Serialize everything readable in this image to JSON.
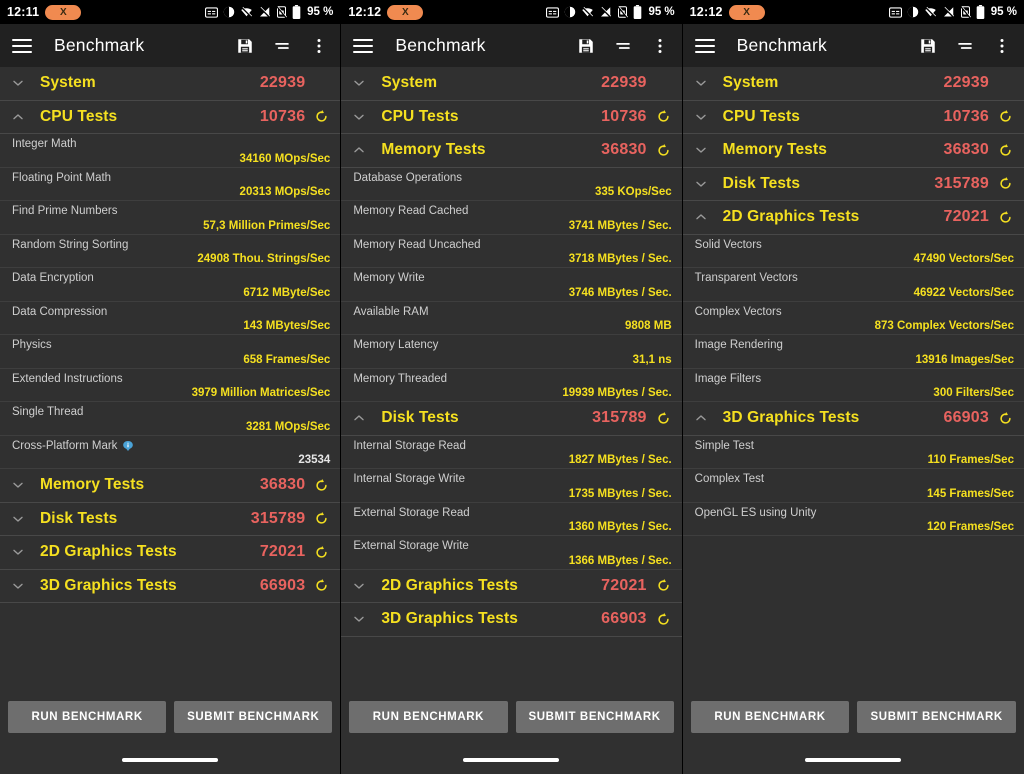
{
  "app": {
    "title": "Benchmark",
    "accent_yellow": "#f5e020",
    "accent_red": "#e8635f",
    "bg": "#303030",
    "appbar_bg": "#212121"
  },
  "status_bar": {
    "times": [
      "12:11",
      "12:12",
      "12:12"
    ],
    "pill_label": "X",
    "battery": "95 %",
    "icons": [
      "caption-icon",
      "dnd-icon",
      "wifi-off-icon",
      "signal-off-icon",
      "sim-off-icon",
      "battery-icon"
    ]
  },
  "appbar": {
    "menu_icon": "hamburger-icon",
    "actions": [
      "save-icon",
      "sort-icon",
      "overflow-icon"
    ]
  },
  "buttons": {
    "run": "RUN BENCHMARK",
    "submit": "SUBMIT BENCHMARK"
  },
  "groups": {
    "system": {
      "label": "System",
      "score": "22939",
      "refresh": false
    },
    "cpu": {
      "label": "CPU Tests",
      "score": "10736",
      "refresh": true
    },
    "memory": {
      "label": "Memory Tests",
      "score": "36830",
      "refresh": true
    },
    "disk": {
      "label": "Disk Tests",
      "score": "315789",
      "refresh": true
    },
    "gfx2d": {
      "label": "2D Graphics Tests",
      "score": "72021",
      "refresh": true
    },
    "gfx3d": {
      "label": "3D Graphics Tests",
      "score": "66903",
      "refresh": true
    }
  },
  "tests": {
    "cpu": [
      {
        "name": "Integer Math",
        "value": "34160 MOps/Sec"
      },
      {
        "name": "Floating Point Math",
        "value": "20313 MOps/Sec"
      },
      {
        "name": "Find Prime Numbers",
        "value": "57,3 Million Primes/Sec"
      },
      {
        "name": "Random String Sorting",
        "value": "24908 Thou. Strings/Sec"
      },
      {
        "name": "Data Encryption",
        "value": "6712 MByte/Sec"
      },
      {
        "name": "Data Compression",
        "value": "143 MBytes/Sec"
      },
      {
        "name": "Physics",
        "value": "658 Frames/Sec"
      },
      {
        "name": "Extended Instructions",
        "value": "3979 Million Matrices/Sec"
      },
      {
        "name": "Single Thread",
        "value": "3281 MOps/Sec"
      },
      {
        "name": "Cross-Platform Mark",
        "value": "23534",
        "info": true,
        "plain": true
      }
    ],
    "memory": [
      {
        "name": "Database Operations",
        "value": "335 KOps/Sec"
      },
      {
        "name": "Memory Read Cached",
        "value": "3741 MBytes / Sec."
      },
      {
        "name": "Memory Read Uncached",
        "value": "3718 MBytes / Sec."
      },
      {
        "name": "Memory Write",
        "value": "3746 MBytes / Sec."
      },
      {
        "name": "Available RAM",
        "value": "9808 MB"
      },
      {
        "name": "Memory Latency",
        "value": "31,1 ns"
      },
      {
        "name": "Memory Threaded",
        "value": "19939 MBytes / Sec."
      }
    ],
    "disk": [
      {
        "name": "Internal Storage Read",
        "value": "1827 MBytes / Sec."
      },
      {
        "name": "Internal Storage Write",
        "value": "1735 MBytes / Sec."
      },
      {
        "name": "External Storage Read",
        "value": "1360 MBytes / Sec."
      },
      {
        "name": "External Storage Write",
        "value": "1366 MBytes / Sec."
      }
    ],
    "gfx2d": [
      {
        "name": "Solid Vectors",
        "value": "47490 Vectors/Sec"
      },
      {
        "name": "Transparent Vectors",
        "value": "46922 Vectors/Sec"
      },
      {
        "name": "Complex Vectors",
        "value": "873 Complex Vectors/Sec"
      },
      {
        "name": "Image Rendering",
        "value": "13916 Images/Sec"
      },
      {
        "name": "Image Filters",
        "value": "300 Filters/Sec"
      }
    ],
    "gfx3d": [
      {
        "name": "Simple Test",
        "value": "110 Frames/Sec"
      },
      {
        "name": "Complex Test",
        "value": "145 Frames/Sec"
      },
      {
        "name": "OpenGL ES using Unity",
        "value": "120 Frames/Sec"
      }
    ]
  },
  "panels": [
    {
      "time_index": 0,
      "order": [
        "system",
        "cpu",
        "memory",
        "disk",
        "gfx2d",
        "gfx3d"
      ],
      "expanded": "cpu"
    },
    {
      "time_index": 1,
      "order": [
        "system",
        "cpu",
        "memory",
        "disk",
        "gfx2d",
        "gfx3d"
      ],
      "expanded": "memory,disk"
    },
    {
      "time_index": 2,
      "order": [
        "system",
        "cpu",
        "memory",
        "disk",
        "gfx2d",
        "gfx3d"
      ],
      "expanded": "gfx2d,gfx3d"
    }
  ]
}
